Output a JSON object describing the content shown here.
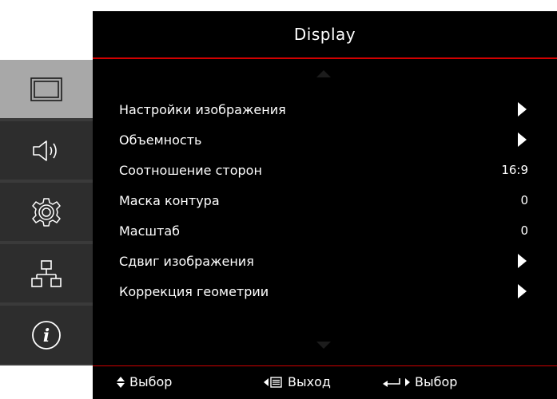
{
  "title": "Display",
  "sidebar": {
    "items": [
      {
        "icon": "display-icon",
        "selected": true
      },
      {
        "icon": "audio-icon",
        "selected": false
      },
      {
        "icon": "settings-icon",
        "selected": false
      },
      {
        "icon": "network-icon",
        "selected": false
      },
      {
        "icon": "info-icon",
        "selected": false
      }
    ]
  },
  "menu": {
    "items": [
      {
        "label": "Настройки изображения",
        "value": "",
        "submenu": true
      },
      {
        "label": "Объемность",
        "value": "",
        "submenu": true
      },
      {
        "label": "Соотношение сторон",
        "value": "16:9",
        "submenu": false
      },
      {
        "label": "Маска контура",
        "value": "0",
        "submenu": false
      },
      {
        "label": "Масштаб",
        "value": "0",
        "submenu": false
      },
      {
        "label": "Сдвиг изображения",
        "value": "",
        "submenu": true
      },
      {
        "label": "Коррекция геометрии",
        "value": "",
        "submenu": true
      }
    ]
  },
  "footer": {
    "select_updown_label": "Выбор",
    "exit_label": "Выход",
    "enter_label": "Выбор"
  },
  "colors": {
    "accent": "#d00000",
    "background": "#000000",
    "sidebar": "#2d2d2d",
    "sidebar_selected": "#a8a8a8"
  }
}
